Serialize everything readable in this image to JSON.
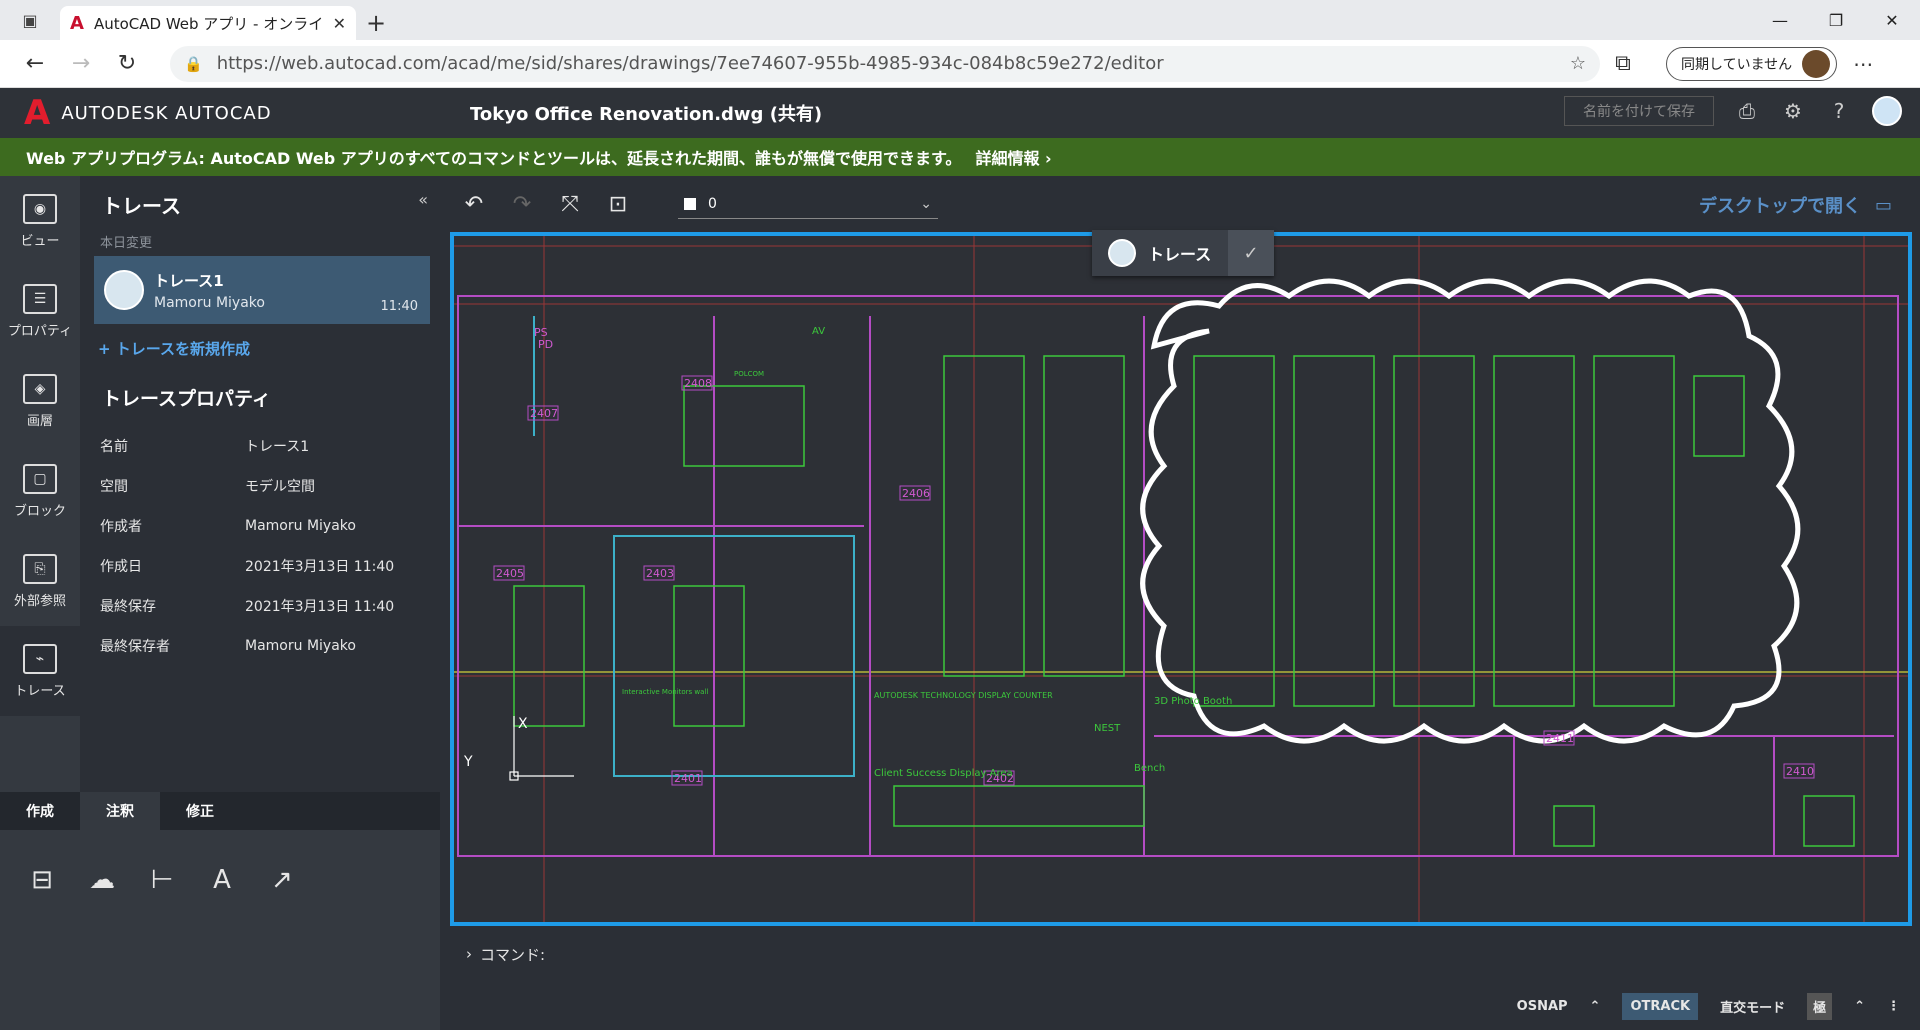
{
  "browser": {
    "tab_title": "AutoCAD Web アプリ - オンライン C",
    "url": "https://web.autocad.com/acad/me/sid/shares/drawings/7ee74607-955b-4985-934c-084b8c59e272/editor",
    "sync_label": "同期していません"
  },
  "app": {
    "brand": "AUTODESK AUTOCAD",
    "doc_title": "Tokyo Office Renovation.dwg (共有)",
    "save_as": "名前を付けて保存"
  },
  "banner": {
    "text": "Web アプリプログラム: AutoCAD Web アプリのすべてのコマンドとツールは、延長された期間、誰もが無償で使用できます。",
    "link": "詳細情報 ›"
  },
  "rail": [
    {
      "label": "ビュー",
      "icon": "eye-icon"
    },
    {
      "label": "プロパティ",
      "icon": "properties-icon"
    },
    {
      "label": "画層",
      "icon": "layers-icon"
    },
    {
      "label": "ブロック",
      "icon": "block-icon"
    },
    {
      "label": "外部参照",
      "icon": "xref-icon"
    },
    {
      "label": "トレース",
      "icon": "trace-icon"
    }
  ],
  "panel": {
    "title": "トレース",
    "section": "本日変更",
    "trace": {
      "name": "トレース1",
      "owner": "Mamoru Miyako",
      "time": "11:40"
    },
    "new_trace": "+ トレースを新規作成",
    "props_title": "トレースプロパティ",
    "props": [
      {
        "k": "名前",
        "v": "トレース1"
      },
      {
        "k": "空間",
        "v": "モデル空間"
      },
      {
        "k": "作成者",
        "v": "Mamoru Miyako"
      },
      {
        "k": "作成日",
        "v": "2021年3月13日 11:40"
      },
      {
        "k": "最終保存",
        "v": "2021年3月13日 11:40"
      },
      {
        "k": "最終保存者",
        "v": "Mamoru Miyako"
      }
    ]
  },
  "tooltabs": [
    "作成",
    "注釈",
    "修正"
  ],
  "toolbar": {
    "layer_value": "0",
    "desktop_open": "デスクトップで開く"
  },
  "canvas": {
    "trace_tag": "トレース",
    "rooms": [
      "2408",
      "2407",
      "2405",
      "2403",
      "2402",
      "2401",
      "2411",
      "2410",
      "2406"
    ],
    "labels": {
      "ps": "PS",
      "pd": "PD",
      "av": "AV",
      "photo": "3D Photo Booth",
      "nest": "NEST",
      "bench": "Bench",
      "client": "Client Success Display Area",
      "display": "AUTODESK TECHNOLOGY DISPLAY COUNTER",
      "monitors": "Interactive Monitors wall",
      "polcom": "POLCOM",
      "y_axis": "Y",
      "x_axis": "X"
    }
  },
  "command": {
    "prompt": "コマンド:"
  },
  "status": {
    "osnap": "OSNAP",
    "otrack": "OTRACK",
    "ortho": "直交モード",
    "polar": "極"
  }
}
